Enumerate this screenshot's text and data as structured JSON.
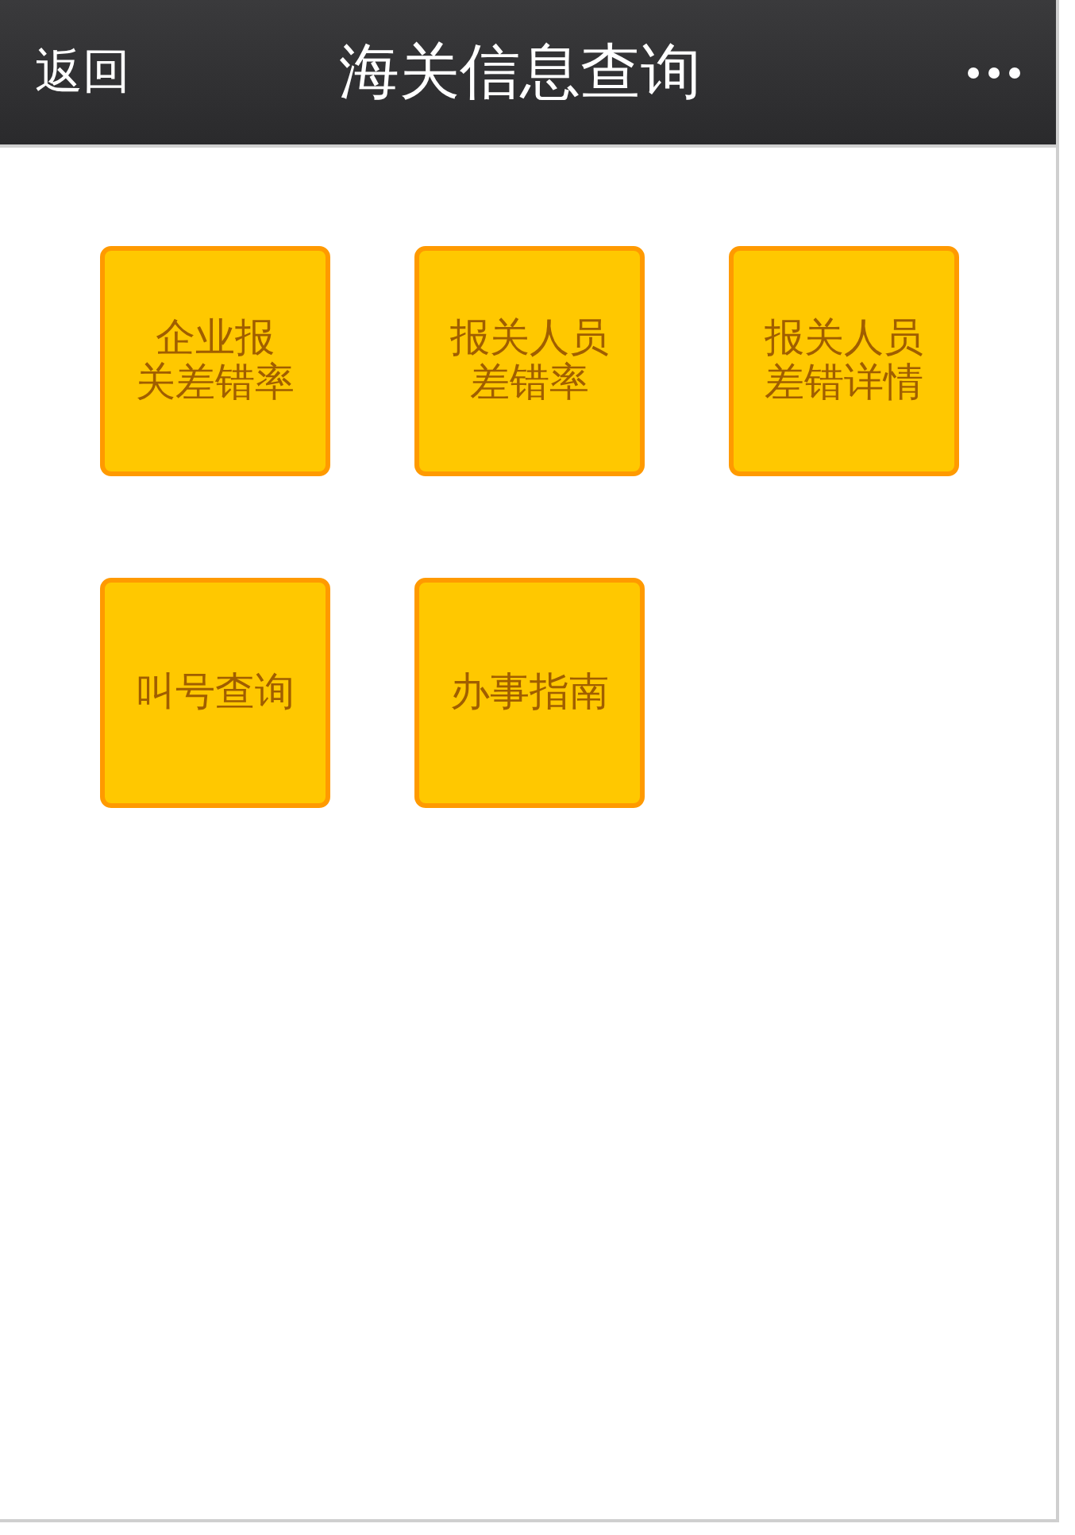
{
  "header": {
    "back": "返回",
    "title": "海关信息查询"
  },
  "tiles": [
    {
      "lines": [
        "企业报",
        "关差错率"
      ]
    },
    {
      "lines": [
        "报关人员",
        "差错率"
      ]
    },
    {
      "lines": [
        "报关人员",
        "差错详情"
      ]
    },
    {
      "lines": [
        "叫号查询"
      ]
    },
    {
      "lines": [
        "办事指南"
      ]
    }
  ]
}
